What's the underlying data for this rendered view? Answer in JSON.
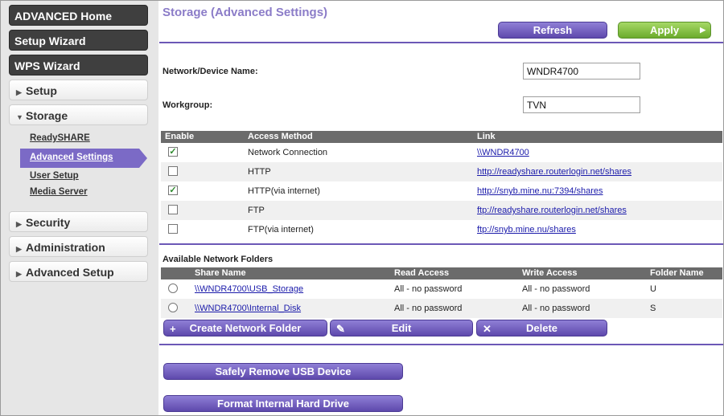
{
  "sidebar": {
    "advanced_home": "ADVANCED Home",
    "setup_wizard": "Setup Wizard",
    "wps_wizard": "WPS Wizard",
    "setup": "Setup",
    "storage": "Storage",
    "storage_items": [
      "ReadySHARE",
      "Advanced Settings",
      "User Setup",
      "Media Server"
    ],
    "security": "Security",
    "administration": "Administration",
    "advanced_setup": "Advanced Setup"
  },
  "main": {
    "title": "Storage (Advanced Settings)",
    "refresh_label": "Refresh",
    "apply_label": "Apply",
    "device_name_label": "Network/Device Name:",
    "device_name_value": "WNDR4700",
    "workgroup_label": "Workgroup:",
    "workgroup_value": "TVN",
    "access": {
      "headers": [
        "Enable",
        "Access Method",
        "Link"
      ],
      "rows": [
        {
          "enabled": true,
          "method": "Network Connection",
          "link": "\\\\WNDR4700"
        },
        {
          "enabled": false,
          "method": "HTTP",
          "link": "http://readyshare.routerlogin.net/shares"
        },
        {
          "enabled": true,
          "method": "HTTP(via internet)",
          "link": "http://snyb.mine.nu:7394/shares"
        },
        {
          "enabled": false,
          "method": "FTP",
          "link": "ftp://readyshare.routerlogin.net/shares"
        },
        {
          "enabled": false,
          "method": "FTP(via internet)",
          "link": "ftp://snyb.mine.nu/shares"
        }
      ]
    },
    "folders": {
      "section_label": "Available Network Folders",
      "headers": [
        "Share Name",
        "Read Access",
        "Write Access",
        "Folder Name"
      ],
      "rows": [
        {
          "share": "\\\\WNDR4700\\USB_Storage",
          "read": "All - no password",
          "write": "All - no password",
          "folder": "U"
        },
        {
          "share": "\\\\WNDR4700\\Internal_Disk",
          "read": "All - no password",
          "write": "All - no password",
          "folder": "S"
        }
      ]
    },
    "create_label": "Create Network Folder",
    "edit_label": "Edit",
    "delete_label": "Delete",
    "safely_remove_label": "Safely Remove USB Device",
    "format_label": "Format Internal Hard Drive"
  },
  "colors": {
    "accent_purple": "#6c58b6",
    "apply_green": "#7dbd3a",
    "sidebar_dark": "#3f3f3f"
  }
}
